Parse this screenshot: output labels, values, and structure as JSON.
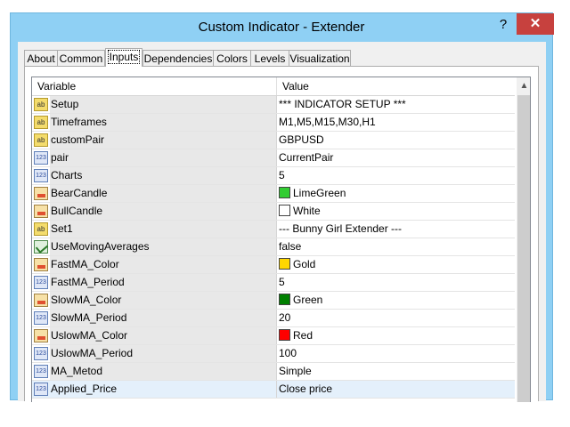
{
  "window": {
    "title": "Custom Indicator - Extender",
    "help_label": "?",
    "close_label": "✕"
  },
  "tabs": [
    {
      "label": "About"
    },
    {
      "label": "Common"
    },
    {
      "label": "Inputs",
      "active": true
    },
    {
      "label": "Dependencies"
    },
    {
      "label": "Colors"
    },
    {
      "label": "Levels"
    },
    {
      "label": "Visualization"
    }
  ],
  "grid": {
    "header_variable": "Variable",
    "header_value": "Value",
    "rows": [
      {
        "icon": "text-icon",
        "variable": "Setup",
        "value": "*** INDICATOR SETUP ***"
      },
      {
        "icon": "text-icon",
        "variable": "Timeframes",
        "value": "M1,M5,M15,M30,H1"
      },
      {
        "icon": "text-icon",
        "variable": "customPair",
        "value": "GBPUSD"
      },
      {
        "icon": "number-icon",
        "variable": "pair",
        "value": "CurrentPair"
      },
      {
        "icon": "number-icon",
        "variable": "Charts",
        "value": "5"
      },
      {
        "icon": "color-icon",
        "variable": "BearCandle",
        "value": "LimeGreen",
        "swatch": "#32cd32"
      },
      {
        "icon": "color-icon",
        "variable": "BullCandle",
        "value": "White",
        "swatch": "#ffffff"
      },
      {
        "icon": "text-icon",
        "variable": "Set1",
        "value": "--- Bunny Girl Extender ---"
      },
      {
        "icon": "bool-icon",
        "variable": "UseMovingAverages",
        "value": "false"
      },
      {
        "icon": "color-icon",
        "variable": "FastMA_Color",
        "value": "Gold",
        "swatch": "#ffd700"
      },
      {
        "icon": "number-icon",
        "variable": "FastMA_Period",
        "value": "5"
      },
      {
        "icon": "color-icon",
        "variable": "SlowMA_Color",
        "value": "Green",
        "swatch": "#008000"
      },
      {
        "icon": "number-icon",
        "variable": "SlowMA_Period",
        "value": "20"
      },
      {
        "icon": "color-icon",
        "variable": "UslowMA_Color",
        "value": "Red",
        "swatch": "#ff0000"
      },
      {
        "icon": "number-icon",
        "variable": "UslowMA_Period",
        "value": "100"
      },
      {
        "icon": "number-icon",
        "variable": "MA_Metod",
        "value": "Simple"
      },
      {
        "icon": "number-icon",
        "variable": "Applied_Price",
        "value": "Close price"
      }
    ]
  },
  "colors": {
    "titlebar": "#8fd0f4",
    "close_button": "#c7413e",
    "selected_row": "#e4f0fb"
  }
}
